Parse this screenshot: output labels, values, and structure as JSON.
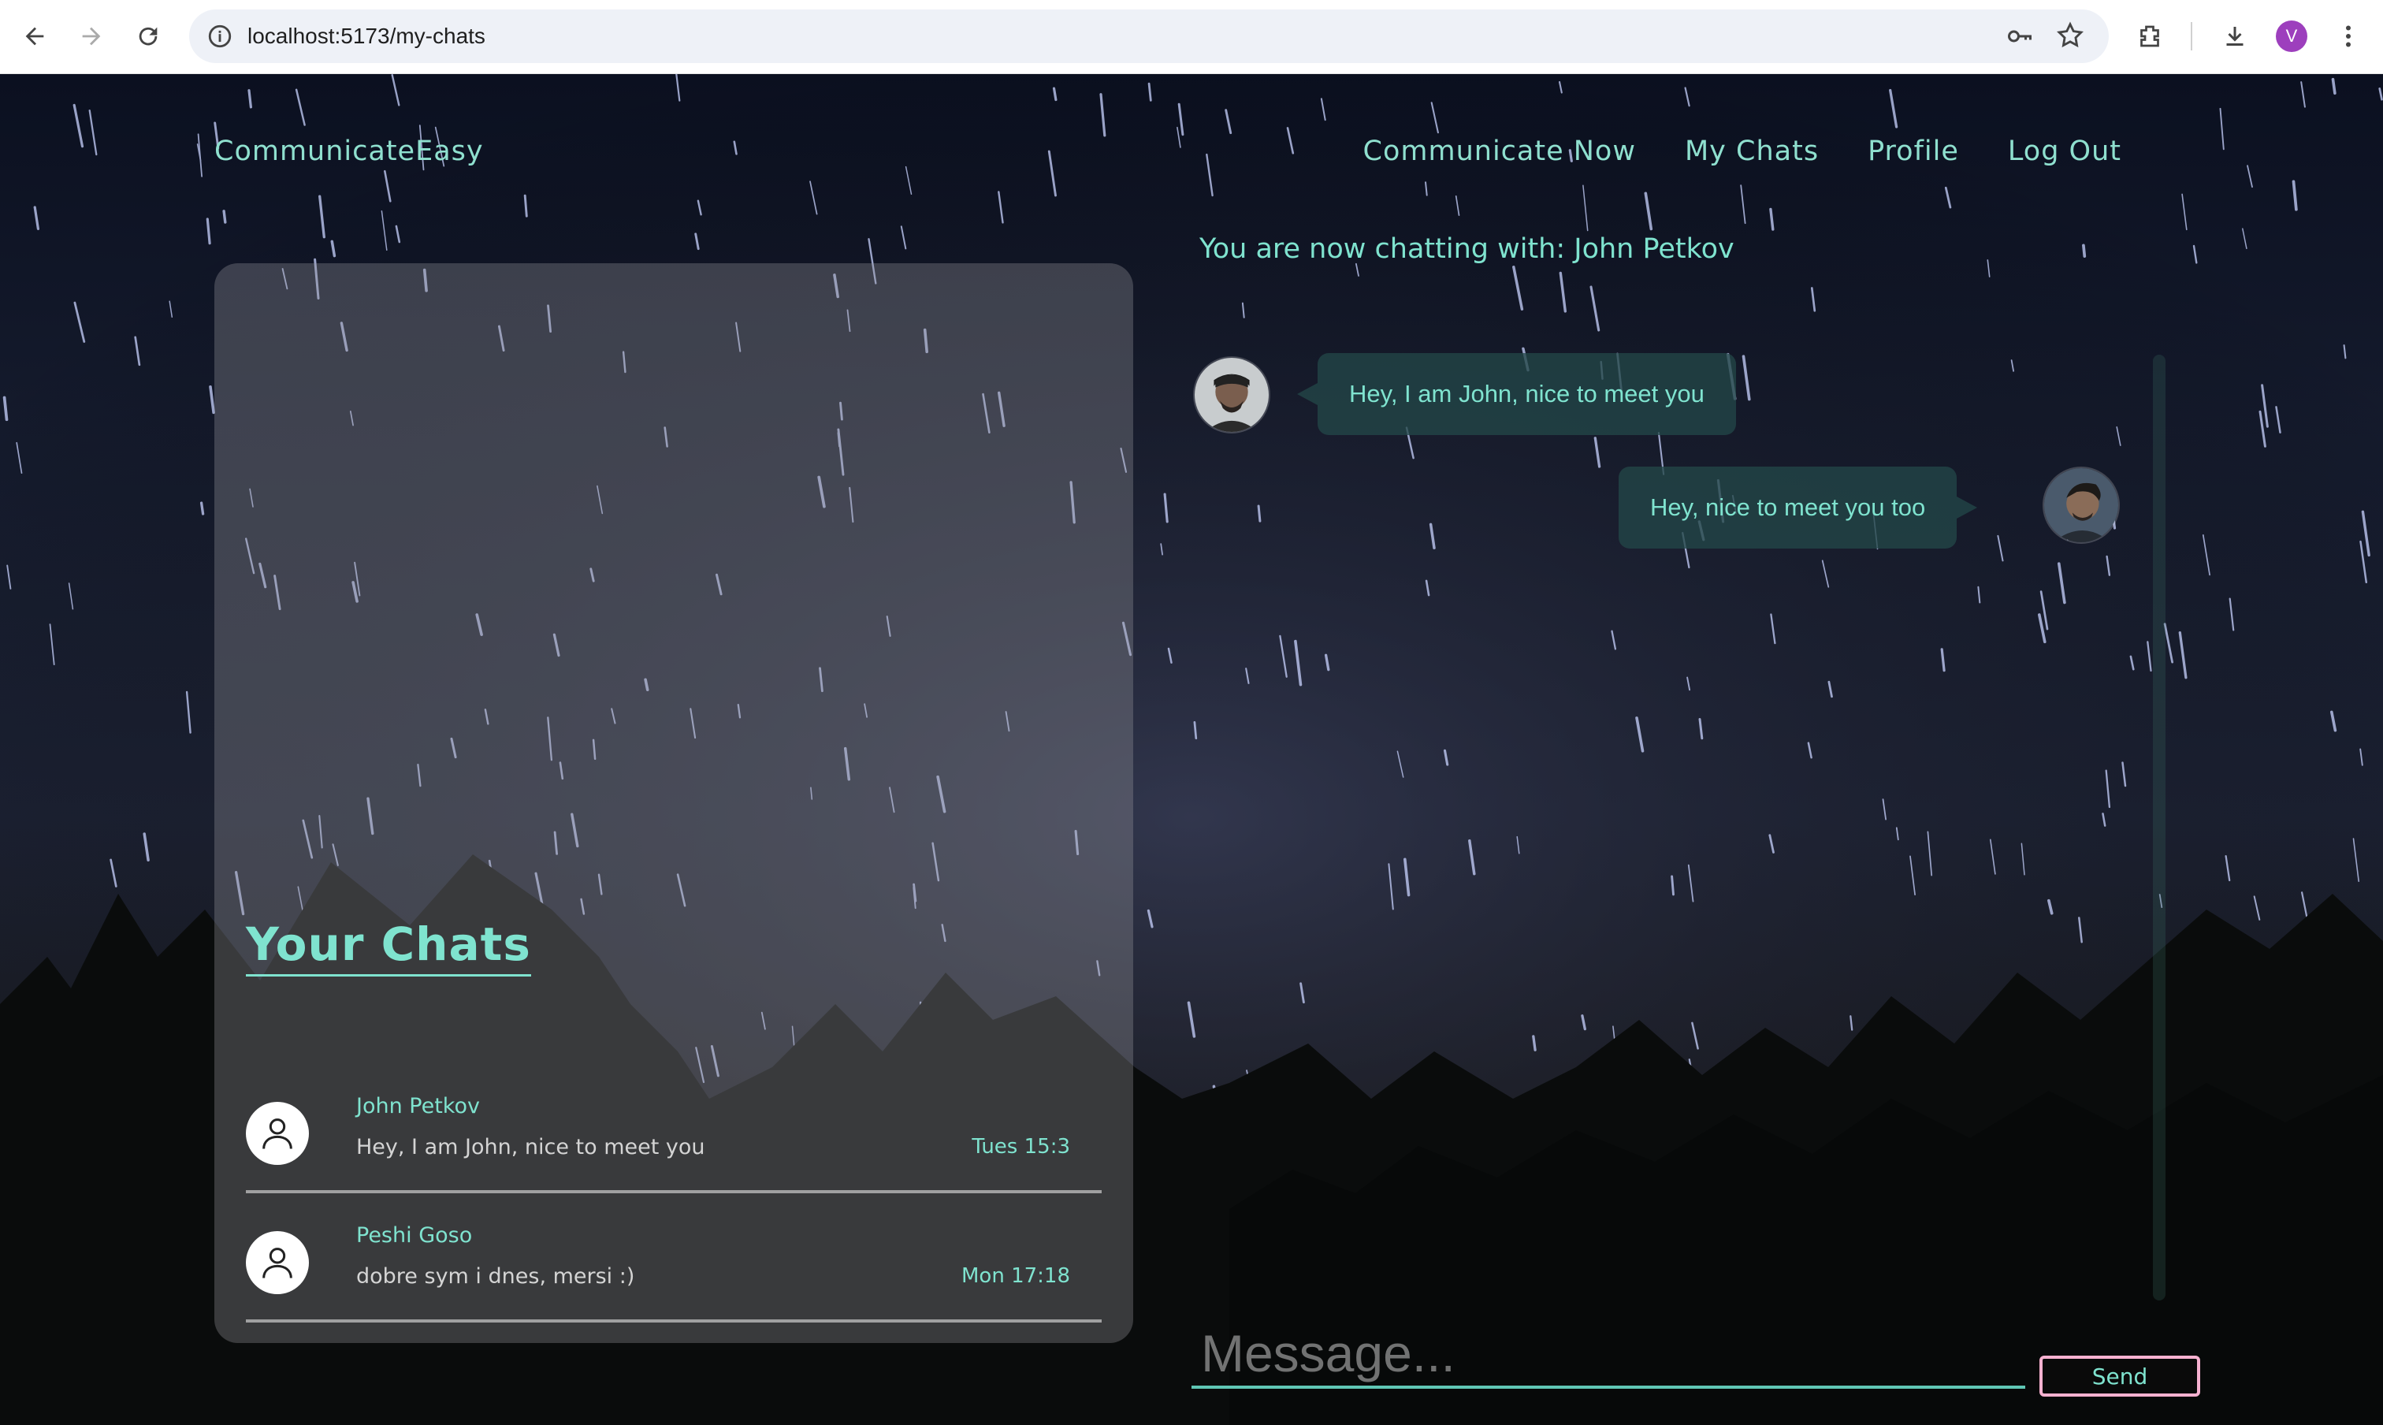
{
  "browser": {
    "url": "localhost:5173/my-chats",
    "profile_initial": "V",
    "icons": [
      "back-icon",
      "forward-icon",
      "reload-icon",
      "info-icon",
      "key-icon",
      "star-icon",
      "extensions-icon",
      "download-icon",
      "menu-icon"
    ]
  },
  "header": {
    "brand": "CommunicateEasy",
    "nav": [
      "Communicate Now",
      "My Chats",
      "Profile",
      "Log Out"
    ]
  },
  "chats": {
    "title": "Your Chats",
    "items": [
      {
        "name": "John Petkov",
        "preview": "Hey, I am John, nice to meet you",
        "time": "Tues 15:3"
      },
      {
        "name": "Peshi Goso",
        "preview": "dobre sym i dnes, mersi :)",
        "time": "Mon 17:18"
      }
    ]
  },
  "conversation": {
    "header": "You are now chatting with: John Petkov",
    "messages": [
      {
        "side": "left",
        "text": "Hey, I am John, nice to meet you"
      },
      {
        "side": "right",
        "text": "Hey, nice to meet you too"
      }
    ]
  },
  "composer": {
    "placeholder": "Message...",
    "send_label": "Send"
  },
  "colors": {
    "accent": "#7fe3cf",
    "send_border": "#f7b1d0",
    "bubble": "#224648"
  }
}
